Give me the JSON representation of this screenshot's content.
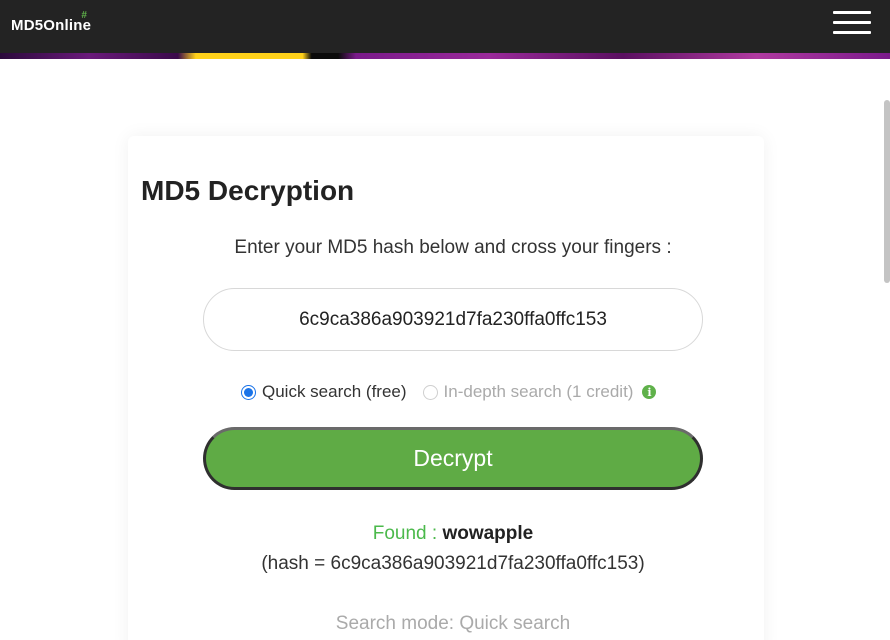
{
  "header": {
    "logo_text": "MD5Online",
    "logo_mark": "#",
    "menu_icon": "hamburger-icon"
  },
  "main": {
    "title": "MD5 Decryption",
    "subtitle": "Enter your MD5 hash below and cross your fingers :",
    "hash_input_value": "6c9ca386a903921d7fa230ffa0ffc153",
    "options": {
      "quick_label": "Quick search (free)",
      "indepth_label": "In-depth search (1 credit)",
      "info_icon": "info-icon"
    },
    "decrypt_label": "Decrypt",
    "result": {
      "found_label": "Found : ",
      "found_value": "wowapple",
      "hash_line": "(hash = 6c9ca386a903921d7fa230ffa0ffc153)",
      "mode_line": "Search mode: Quick search"
    }
  },
  "colors": {
    "accent_green": "#5fab45",
    "found_green": "#4bb94b",
    "header_bg": "#232323"
  }
}
